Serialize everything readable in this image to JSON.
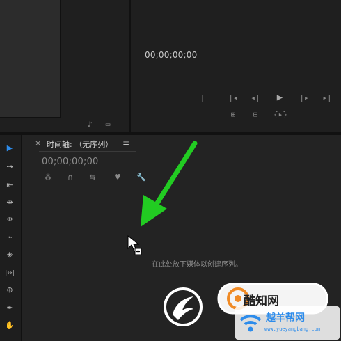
{
  "source_panel": {
    "controls": [
      "♪",
      "▭"
    ]
  },
  "program_monitor": {
    "timecode": "00;00;00;00",
    "transport": {
      "mark_in": "|",
      "go_in": "|◂",
      "step_back": "◂|",
      "play": "▶",
      "step_forward": "|▸",
      "go_out": "▸|"
    },
    "secondary": [
      "⊞",
      "⊟",
      "{▸}"
    ]
  },
  "timeline": {
    "close": "×",
    "title": "时间轴: （无序列）",
    "menu": "≡",
    "timecode": "00;00;00;00",
    "hint": "在此处放下媒体以创建序列。"
  },
  "tools": [
    {
      "name": "selection-tool",
      "glyph": "▶"
    },
    {
      "name": "track-select-tool",
      "glyph": "⇢"
    },
    {
      "name": "ripple-edit-tool",
      "glyph": "⇤"
    },
    {
      "name": "rolling-edit-tool",
      "glyph": "⇹"
    },
    {
      "name": "rate-stretch-tool",
      "glyph": "⇼"
    },
    {
      "name": "razor-tool",
      "glyph": "⌁"
    },
    {
      "name": "slip-tool",
      "glyph": "◈"
    },
    {
      "name": "slide-tool",
      "glyph": "|↔|"
    },
    {
      "name": "pen-tool",
      "glyph": "⊕"
    },
    {
      "name": "pen-icon",
      "glyph": "✒"
    },
    {
      "name": "hand-tool",
      "glyph": "✋"
    }
  ],
  "watermark": {
    "badge_text": "酷知网",
    "site_text": "越羊帮网",
    "site_url": "www.yueyangbang.com"
  },
  "colors": {
    "accent_blue": "#2d8ceb",
    "arrow_green": "#22cc22",
    "badge_orange": "#f08a24"
  }
}
